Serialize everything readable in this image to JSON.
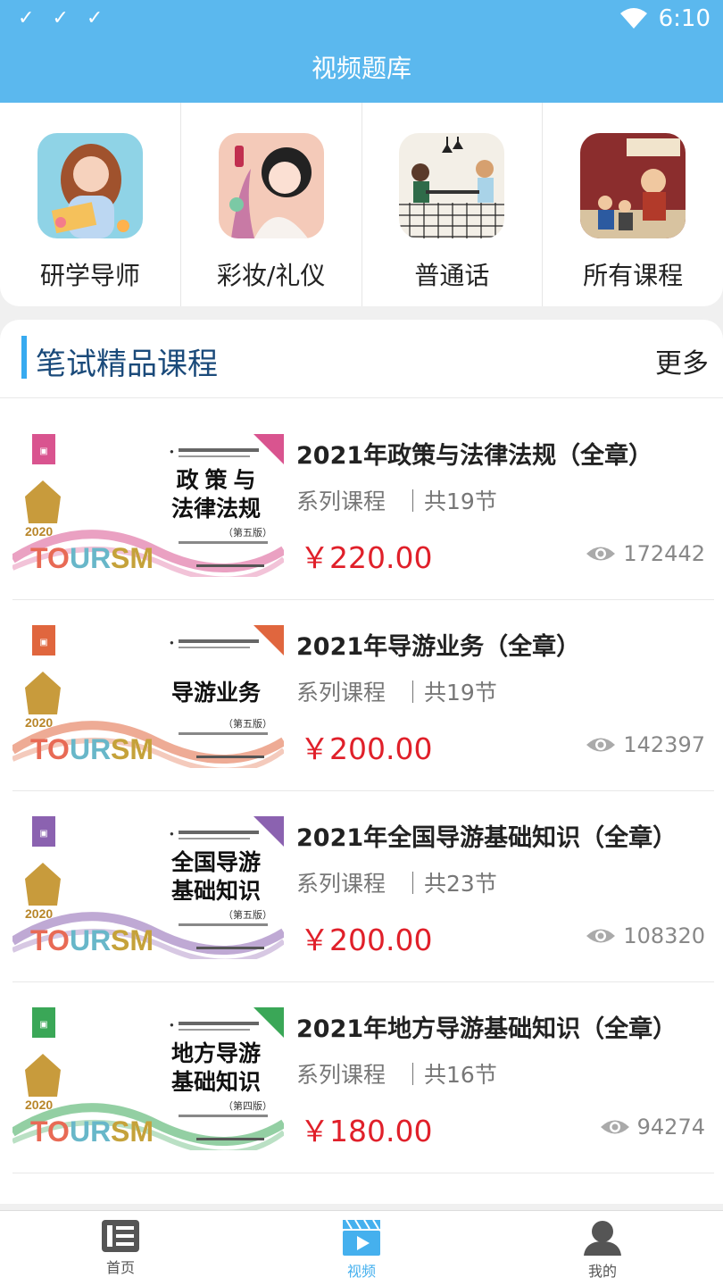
{
  "status_bar": {
    "time": "6:10",
    "icons": [
      "check-icon",
      "check-icon",
      "check-icon",
      "wifi-icon",
      "battery-icon"
    ]
  },
  "app_bar": {
    "title": "视频题库"
  },
  "categories": [
    {
      "label": "研学导师"
    },
    {
      "label": "彩妆/礼仪"
    },
    {
      "label": "普通话"
    },
    {
      "label": "所有课程"
    }
  ],
  "section": {
    "title": "笔试精品课程",
    "more": "更多"
  },
  "courses": [
    {
      "title": "2021年政策与法律法规（全章）",
      "series": "系列课程",
      "lessons": "｜共19节",
      "price": "￥220.00",
      "views": "172442",
      "cover": {
        "line1": "政 策 与",
        "line2": "法律法规",
        "edition": "（第五版）",
        "year": "2020",
        "accent": "#d9548f"
      }
    },
    {
      "title": "2021年导游业务（全章）",
      "series": "系列课程",
      "lessons": "｜共19节",
      "price": "￥200.00",
      "views": "142397",
      "cover": {
        "line1": "导游业务",
        "line2": "",
        "edition": "（第五版）",
        "year": "2020",
        "accent": "#e0663e"
      }
    },
    {
      "title": "2021年全国导游基础知识（全章）",
      "series": "系列课程",
      "lessons": "｜共23节",
      "price": "￥200.00",
      "views": "108320",
      "cover": {
        "line1": "全国导游",
        "line2": "基础知识",
        "edition": "（第五版）",
        "year": "2020",
        "accent": "#8b62b0"
      }
    },
    {
      "title": "2021年地方导游基础知识（全章）",
      "series": "系列课程",
      "lessons": "｜共16节",
      "price": "￥180.00",
      "views": "94274",
      "cover": {
        "line1": "地方导游",
        "line2": "基础知识",
        "edition": "（第四版）",
        "year": "2020",
        "accent": "#3aa757"
      }
    }
  ],
  "tabs": [
    {
      "label": "首页",
      "icon": "list-icon",
      "active": false
    },
    {
      "label": "视频",
      "icon": "video-icon",
      "active": true
    },
    {
      "label": "我的",
      "icon": "user-icon",
      "active": false
    }
  ],
  "colors": {
    "primary": "#5bb8ee",
    "price": "#e0202a",
    "accent_bar": "#37aaf0"
  }
}
